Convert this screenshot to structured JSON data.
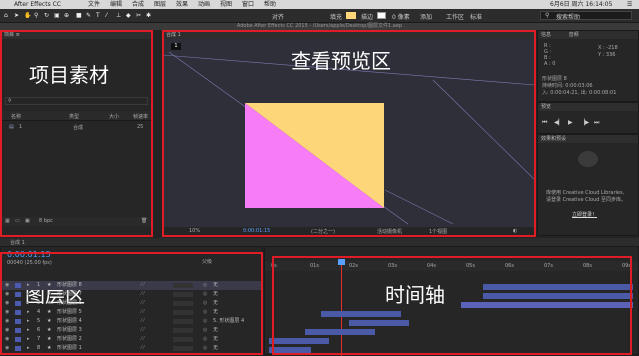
{
  "menubar": {
    "app_name": "After Effects CC",
    "items": [
      "文件",
      "编辑",
      "合成",
      "图层",
      "效果",
      "动画",
      "视图",
      "窗口",
      "帮助"
    ],
    "status": "6月6日 周六 16:14:05"
  },
  "toolbar": {
    "align": "对齐",
    "fill": "填充",
    "stroke": "描边",
    "stroke_px": "0 像素",
    "add": "添加",
    "workspace_label": "工作区",
    "workspace_value": "标准",
    "search": "搜索帮助"
  },
  "window_title": "Adobe After Effects CC 2015 - /Users/apple/Desktop/图层文件1.aep",
  "project": {
    "tab": "项目 ≡",
    "label": "项目素材",
    "columns": [
      "名称",
      "类型",
      "大小",
      "帧速率"
    ],
    "items": [
      {
        "name": "1",
        "type": "合成",
        "fps": "25"
      }
    ],
    "bit_depth": "8 bpc"
  },
  "viewer": {
    "tab": "合成 1",
    "label": "查看预览区",
    "zoom": "10%",
    "timecode": "0:00:01:15",
    "quality": "(二分之一)",
    "camera": "活动摄像机",
    "views": "1个视图",
    "colors": {
      "yellow": "#fdd67a",
      "pink": "#f77df6",
      "bg": "#2f2f3a"
    }
  },
  "info": {
    "tab": "信息",
    "audio_tab": "音频",
    "rgb": [
      "R :",
      "G :",
      "B :",
      "A : 0"
    ],
    "xy": [
      "X : -218",
      "Y : 336"
    ],
    "layer_info": [
      "形状图层 8",
      "持续时间: 0:00:03:06",
      "入: 0:00:04:21, 出: 0:00:08:01"
    ]
  },
  "preview": {
    "tab": "预览"
  },
  "effects": {
    "tab": "效果和预设",
    "cc_text": [
      "库使用 Creative Cloud Libraries,",
      "请登录 Creative Cloud 至同步库。"
    ],
    "login": "立即登录！"
  },
  "timeline": {
    "comp_tab": "合成 1",
    "timecode": "0:00:01:15",
    "fps": "00040 (25.00 fps)",
    "label_layers": "图层区",
    "label_timeline": "时间轴",
    "header_mode": "父级",
    "ruler": [
      "0s",
      "01s",
      "02s",
      "03s",
      "04s",
      "05s",
      "06s",
      "07s",
      "08s",
      "09s"
    ],
    "layers": [
      {
        "num": "1",
        "name": "形状图层 8",
        "parent": "无"
      },
      {
        "num": "2",
        "name": "形状图层 7",
        "parent": "无"
      },
      {
        "num": "3",
        "name": "形状图层 6",
        "parent": "无"
      },
      {
        "num": "4",
        "name": "形状图层 5",
        "parent": "无"
      },
      {
        "num": "5",
        "name": "形状图层 4",
        "parent": "5. 形状图层 4"
      },
      {
        "num": "6",
        "name": "形状图层 3",
        "parent": "无"
      },
      {
        "num": "7",
        "name": "形状图层 2",
        "parent": "无"
      },
      {
        "num": "8",
        "name": "形状图层 1",
        "parent": "无"
      }
    ]
  }
}
